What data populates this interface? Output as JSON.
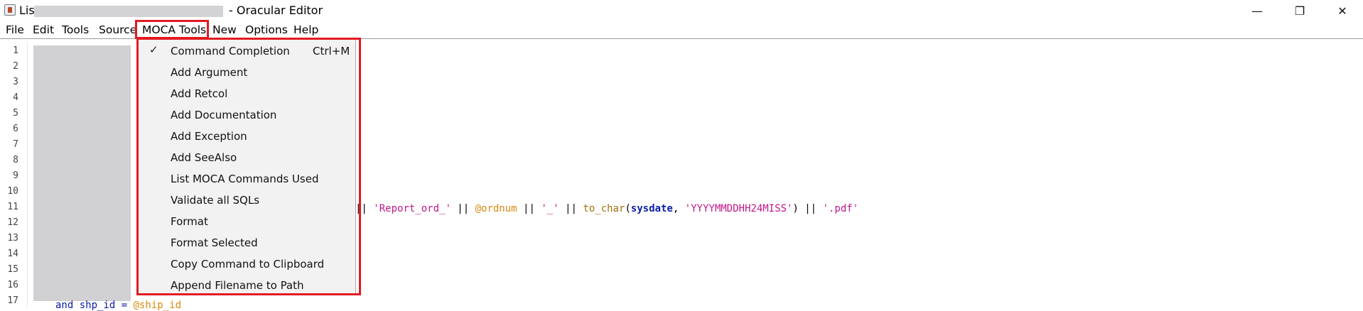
{
  "window": {
    "title_prefix": "Lis",
    "title_suffix": "- Oracular Editor",
    "minimize": "—",
    "maximize": "❐",
    "close": "✕"
  },
  "menubar": {
    "items": [
      "File",
      "Edit",
      "Tools",
      "Source",
      "MOCA Tools",
      "New",
      "Options",
      "Help"
    ]
  },
  "moca_menu": {
    "items": [
      {
        "label": "Command Completion",
        "check": "✓",
        "shortcut": "Ctrl+M"
      },
      {
        "label": "Add Argument"
      },
      {
        "label": "Add Retcol"
      },
      {
        "label": "Add Documentation"
      },
      {
        "label": "Add Exception"
      },
      {
        "label": "Add SeeAlso"
      },
      {
        "label": "List MOCA Commands Used"
      },
      {
        "label": "Validate all SQLs"
      },
      {
        "label": "Format"
      },
      {
        "label": "Format Selected"
      },
      {
        "label": "Copy Command to Clipboard"
      },
      {
        "label": "Append Filename to Path"
      }
    ]
  },
  "editor": {
    "line_numbers": [
      "1",
      "2",
      "3",
      "4",
      "5",
      "6",
      "7",
      "8",
      "9",
      "10",
      "11",
      "12",
      "13",
      "14",
      "15",
      "16",
      "17"
    ],
    "line11": {
      "op1": "|| ",
      "str1": "'Report_ord_'",
      "op2": " || ",
      "var1": "@ordnum",
      "op3": " || ",
      "str2": "'_'",
      "op4": " || ",
      "fn": "to_char",
      "paren_open": "(",
      "kw": "sysdate",
      "comma": ", ",
      "str3": "'YYYYMMDDHH24MISS'",
      "paren_close": ")",
      "op5": " || ",
      "str4": "'.pdf'"
    },
    "bottom_line_prefix": "and shp_id = ",
    "bottom_line_var": "@ship_id"
  }
}
